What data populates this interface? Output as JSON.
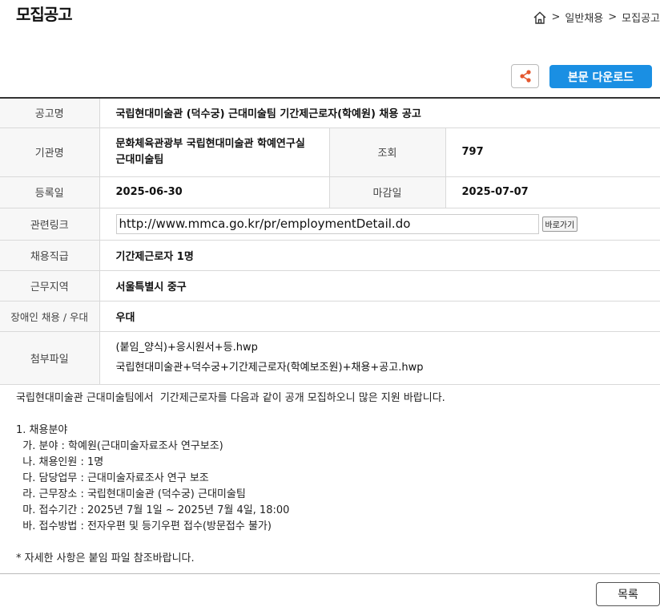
{
  "header": {
    "title": "모집공고",
    "breadcrumb": [
      ">",
      "일반채용",
      ">",
      "모집공고"
    ]
  },
  "toolbar": {
    "share_icon": "share-icon",
    "download_label": "본문 다운로드"
  },
  "notice": {
    "title_label": "공고명",
    "title_value": "국립현대미술관 (덕수궁) 근대미술팀 기간제근로자(학예원) 채용 공고",
    "org_label": "기관명",
    "org_value_line1": "문화체육관광부 국립현대미술관 학예연구실",
    "org_value_line2": "근대미술팀",
    "views_label": "조회",
    "views_value": "797",
    "reg_date_label": "등록일",
    "reg_date_value": "2025-06-30",
    "deadline_label": "마감일",
    "deadline_value": "2025-07-07",
    "link_label": "관련링크",
    "link_value": "http://www.mmca.go.kr/pr/employmentDetail.do",
    "link_go_label": "바로가기",
    "position_label": "채용직급",
    "position_value": "기간제근로자 1명",
    "region_label": "근무지역",
    "region_value": "서울특별시 중구",
    "disability_label": "장애인 채용 / 우대",
    "disability_value": "우대",
    "files_label": "첨부파일",
    "files": [
      "(붙임_양식)+응시원서+등.hwp",
      "국립현대미술관+덕수궁+기간제근로자(학예보조원)+채용+공고.hwp"
    ]
  },
  "body": {
    "lines": [
      "국립현대미술관 근대미술팀에서  기간제근로자를 다음과 같이 공개 모집하오니 많은 지원 바랍니다.",
      "",
      "1. 채용분야",
      "  가. 분야 : 학예원(근대미술자료조사 연구보조)",
      "  나. 채용인원 : 1명",
      "  다. 담당업무 : 근대미술자료조사 연구 보조",
      "  라. 근무장소 : 국립현대미술관 (덕수궁) 근대미술팀",
      "  마. 접수기간 : 2025년 7월 1일 ~ 2025년 7월 4일, 18:00",
      "  바. 접수방법 : 전자우편 및 등기우편 접수(방문접수 불가)",
      "",
      "* 자세한 사항은 붙임 파일 참조바랍니다."
    ]
  },
  "footer": {
    "list_label": "목록"
  }
}
